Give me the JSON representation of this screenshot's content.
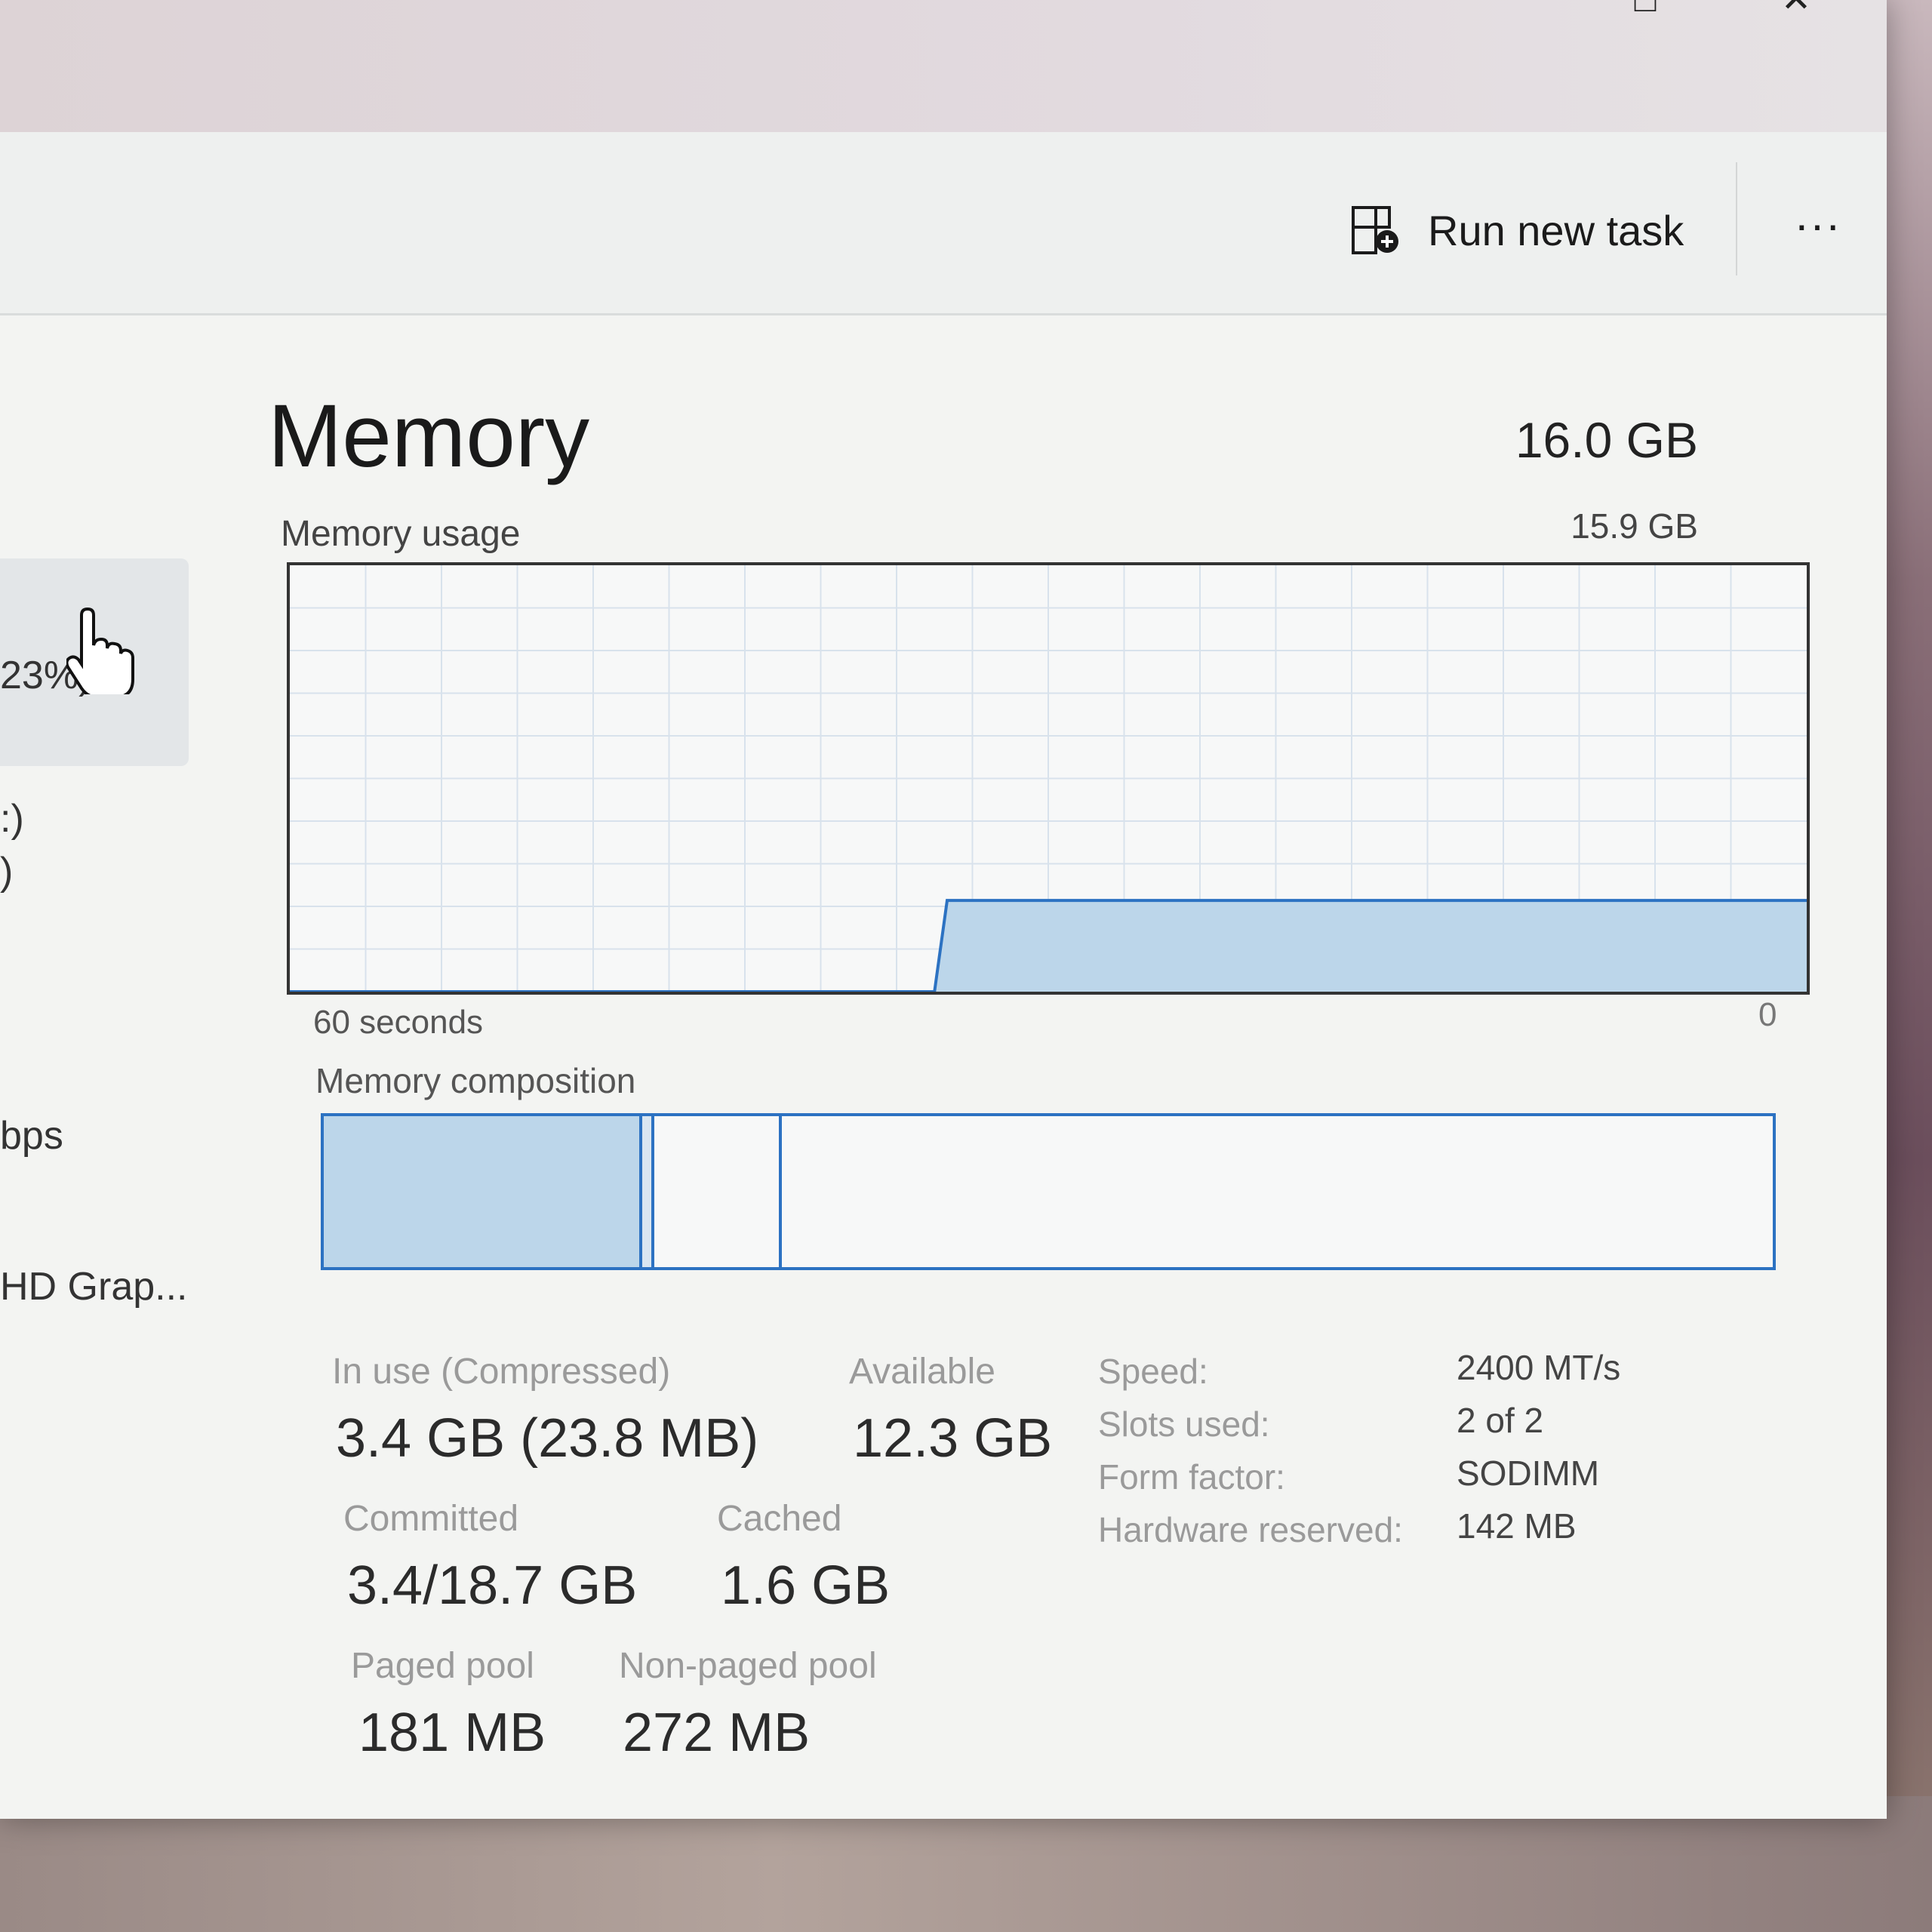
{
  "toolbar": {
    "run_new_task_label": "Run new task",
    "more_label": "..."
  },
  "sidebar": {
    "items": [
      {
        "label": "23%)"
      },
      {
        "label": ":)"
      },
      {
        "label": ")"
      },
      {
        "label": "bps"
      },
      {
        "label": "HD Grap..."
      }
    ]
  },
  "main": {
    "title": "Memory",
    "total": "16.0 GB",
    "usage_label": "Memory usage",
    "usage_max": "15.9 GB",
    "axis_left": "60 seconds",
    "axis_right": "0",
    "composition_label": "Memory composition"
  },
  "chart_data": {
    "type": "area",
    "title": "Memory usage",
    "xlabel": "",
    "ylabel": "",
    "x_range_seconds": [
      60,
      0
    ],
    "ylim": [
      0,
      15.9
    ],
    "series": [
      {
        "x": [
          60,
          34.5,
          34,
          0
        ],
        "values": [
          0,
          0,
          3.4,
          3.4
        ]
      }
    ],
    "grid": true,
    "accent": "#2c72c2"
  },
  "composition": {
    "in_use_gb": 3.4,
    "modified_gb": 0.1,
    "standby_gb": 1.6,
    "free_gb": 10.9
  },
  "stats": {
    "in_use_label": "In use (Compressed)",
    "in_use_value": "3.4 GB (23.8 MB)",
    "available_label": "Available",
    "available_value": "12.3 GB",
    "committed_label": "Committed",
    "committed_value": "3.4/18.7 GB",
    "cached_label": "Cached",
    "cached_value": "1.6 GB",
    "paged_pool_label": "Paged pool",
    "paged_pool_value": "181 MB",
    "non_paged_pool_label": "Non-paged pool",
    "non_paged_pool_value": "272 MB"
  },
  "specs": {
    "speed_label": "Speed:",
    "speed_value": "2400 MT/s",
    "slots_label": "Slots used:",
    "slots_value": "2 of 2",
    "form_factor_label": "Form factor:",
    "form_factor_value": "SODIMM",
    "hw_reserved_label": "Hardware reserved:",
    "hw_reserved_value": "142 MB"
  },
  "colors": {
    "accent": "#2c72c2",
    "fill": "#bcd6ea"
  },
  "icons": [
    "run-new-task-icon",
    "more-icon",
    "hand-cursor-icon"
  ]
}
